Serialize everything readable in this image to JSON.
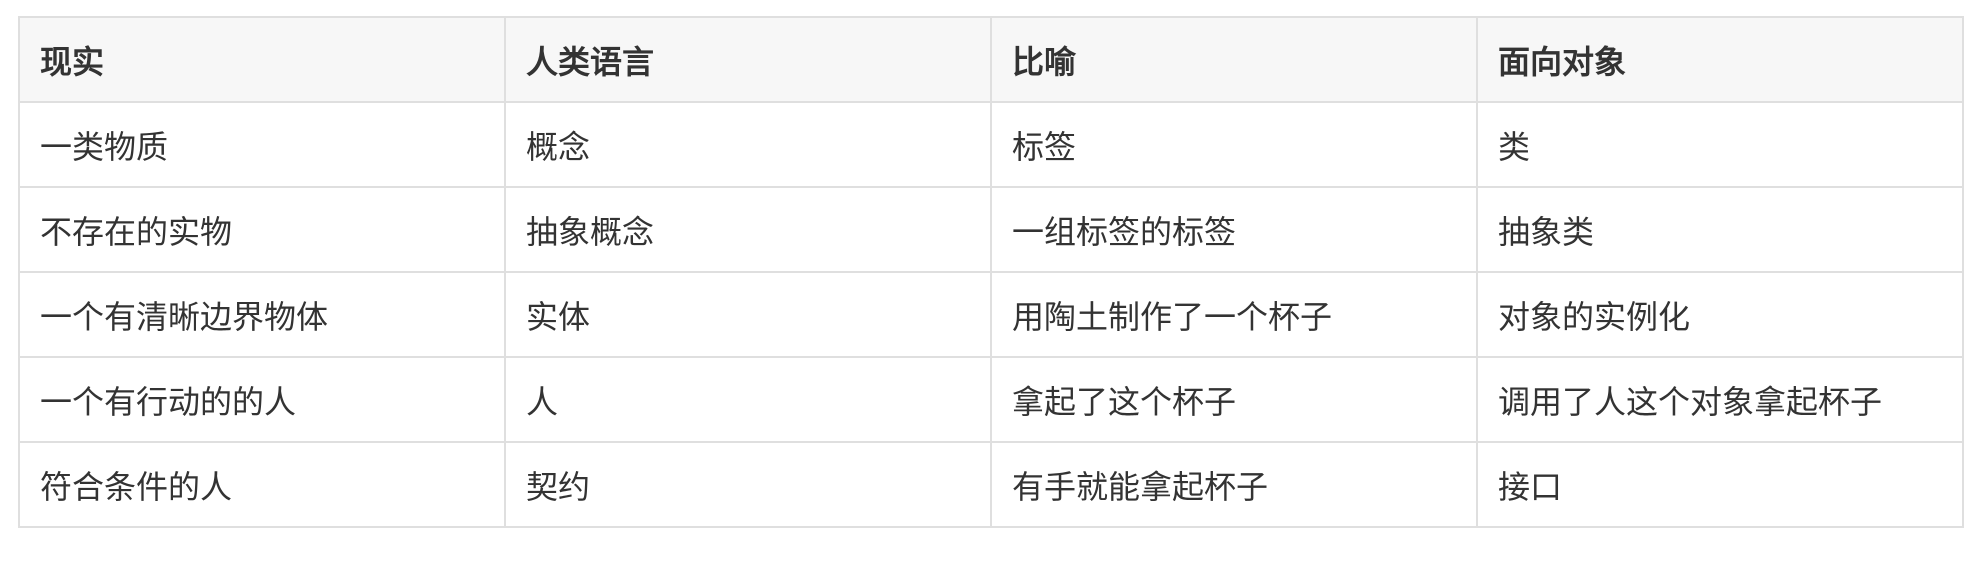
{
  "table": {
    "headers": [
      "现实",
      "人类语言",
      "比喻",
      "面向对象"
    ],
    "rows": [
      [
        "一类物质",
        "概念",
        "标签",
        "类"
      ],
      [
        "不存在的实物",
        "抽象概念",
        "一组标签的标签",
        "抽象类"
      ],
      [
        "一个有清晰边界物体",
        "实体",
        "用陶土制作了一个杯子",
        "对象的实例化"
      ],
      [
        "一个有行动的的人",
        "人",
        "拿起了这个杯子",
        "调用了人这个对象拿起杯子"
      ],
      [
        "符合条件的人",
        "契约",
        "有手就能拿起杯子",
        "接口"
      ]
    ]
  },
  "colors": {
    "header_bg": "#f7f7f7",
    "border": "#dfdfdf",
    "text": "#333333"
  }
}
